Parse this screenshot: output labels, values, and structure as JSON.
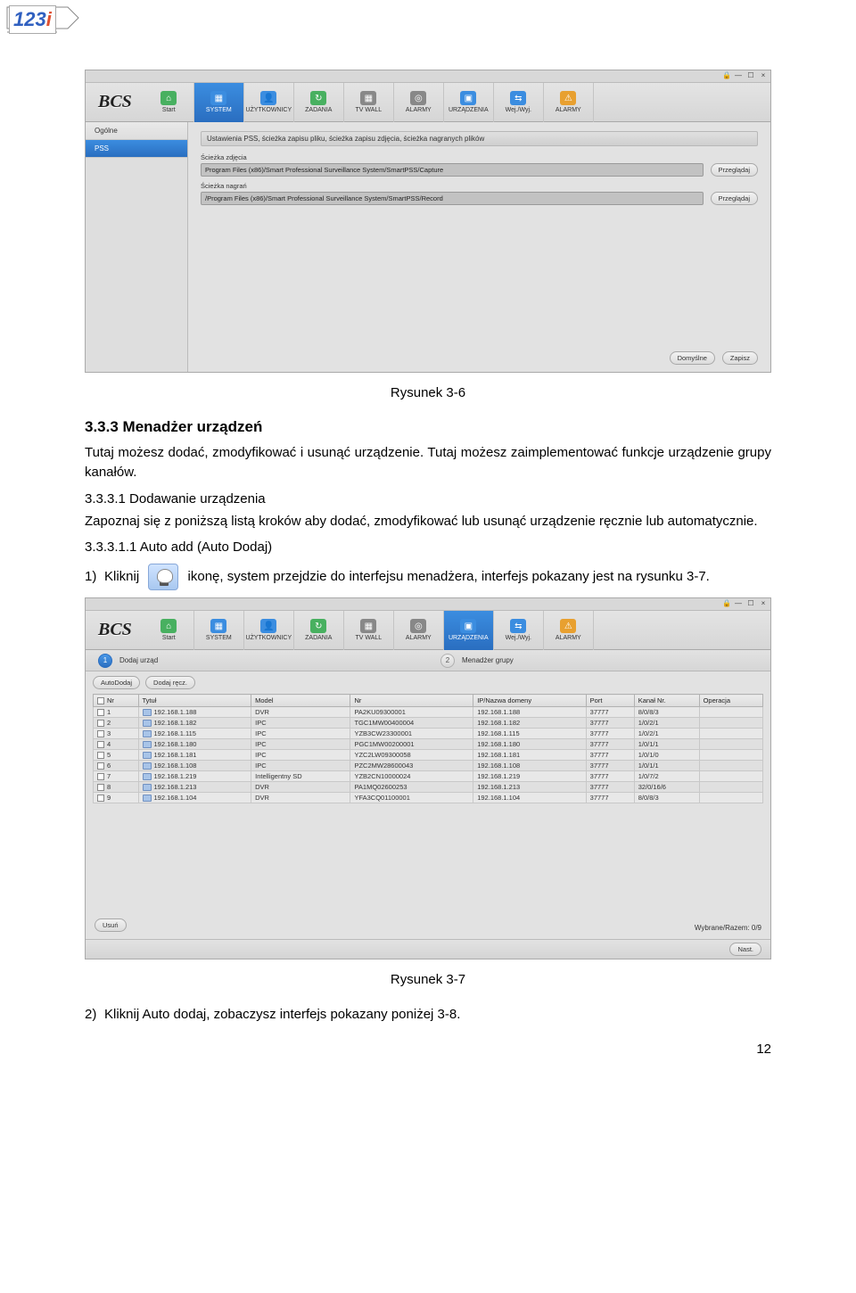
{
  "logo": {
    "part1": "123",
    "part2": "i"
  },
  "shot1": {
    "winbtns": [
      "🔒",
      "—",
      "☐",
      "×"
    ],
    "logo": "BCS",
    "nav": [
      {
        "label": "Start",
        "color": "#48b060",
        "glyph": "⌂"
      },
      {
        "label": "SYSTEM",
        "color": "#3b8de0",
        "glyph": "▦",
        "active": true
      },
      {
        "label": "UŻYTKOWNICY",
        "color": "#3b8de0",
        "glyph": "👤"
      },
      {
        "label": "ZADANIA",
        "color": "#48b060",
        "glyph": "↻"
      },
      {
        "label": "TV WALL",
        "color": "#888",
        "glyph": "▦"
      },
      {
        "label": "ALARMY",
        "color": "#888",
        "glyph": "◎"
      },
      {
        "label": "URZĄDZENIA",
        "color": "#3b8de0",
        "glyph": "▣"
      },
      {
        "label": "Wej./Wyj.",
        "color": "#3b8de0",
        "glyph": "⇆"
      },
      {
        "label": "ALARMY",
        "color": "#e8a030",
        "glyph": "⚠"
      }
    ],
    "sidebar": [
      {
        "label": "Ogólne"
      },
      {
        "label": "PSS",
        "active": true
      }
    ],
    "header": "Ustawienia PSS, ścieżka zapisu pliku, ścieżka zapisu zdjęcia, ścieżka nagranych plików",
    "field1_label": "Ścieżka zdjęcia",
    "field1_value": "Program Files (x86)/Smart Professional Surveillance System/SmartPSS/Capture",
    "field2_label": "Ścieżka nagrań",
    "field2_value": "/Program Files (x86)/Smart Professional Surveillance System/SmartPSS/Record",
    "browse": "Przeglądaj",
    "btn_default": "Domyślne",
    "btn_save": "Zapisz"
  },
  "caption1": "Rysunek 3-6",
  "h3": "3.3.3 Menadżer urządzeń",
  "p1": "Tutaj możesz dodać, zmodyfikować i usunąć urządzenie. Tutaj możesz zaimplementować funkcje urządzenie grupy kanałów.",
  "sub1": "3.3.3.1 Dodawanie urządzenia",
  "p2": "Zapoznaj się z poniższą listą kroków aby dodać, zmodyfikować lub usunąć urządzenie ręcznie lub automatycznie.",
  "sub2": "3.3.3.1.1   Auto add  (Auto Dodaj)",
  "step1_num": "1)",
  "step1a": "Kliknij",
  "step1b": "ikonę, system przejdzie do interfejsu menadżera, interfejs pokazany jest na rysunku 3-7.",
  "shot2": {
    "winbtns": [
      "🔒",
      "—",
      "☐",
      "×"
    ],
    "logo": "BCS",
    "nav": [
      {
        "label": "Start",
        "color": "#48b060",
        "glyph": "⌂"
      },
      {
        "label": "SYSTEM",
        "color": "#3b8de0",
        "glyph": "▦"
      },
      {
        "label": "UŻYTKOWNICY",
        "color": "#3b8de0",
        "glyph": "👤"
      },
      {
        "label": "ZADANIA",
        "color": "#48b060",
        "glyph": "↻"
      },
      {
        "label": "TV WALL",
        "color": "#888",
        "glyph": "▦"
      },
      {
        "label": "ALARMY",
        "color": "#888",
        "glyph": "◎"
      },
      {
        "label": "URZĄDZENIA",
        "color": "#3b8de0",
        "glyph": "▣",
        "active": true
      },
      {
        "label": "Wej./Wyj.",
        "color": "#3b8de0",
        "glyph": "⇆"
      },
      {
        "label": "ALARMY",
        "color": "#e8a030",
        "glyph": "⚠"
      }
    ],
    "step1": "Dodaj urząd",
    "step2": "Menadżer grupy",
    "btn_auto": "AutoDodaj",
    "btn_man": "Dodaj ręcz.",
    "cols": [
      "Nr",
      "Tytuł",
      "Model",
      "Nr",
      "IP/Nazwa domeny",
      "Port",
      "Kanał Nr.",
      "Operacja"
    ],
    "rows": [
      [
        "1",
        "192.168.1.188",
        "DVR",
        "PA2KU09300001",
        "192.168.1.188",
        "37777",
        "8/0/8/3",
        ""
      ],
      [
        "2",
        "192.168.1.182",
        "IPC",
        "TGC1MW00400004",
        "192.168.1.182",
        "37777",
        "1/0/2/1",
        ""
      ],
      [
        "3",
        "192.168.1.115",
        "IPC",
        "YZB3CW23300001",
        "192.168.1.115",
        "37777",
        "1/0/2/1",
        ""
      ],
      [
        "4",
        "192.168.1.180",
        "IPC",
        "PGC1MW00200001",
        "192.168.1.180",
        "37777",
        "1/0/1/1",
        ""
      ],
      [
        "5",
        "192.168.1.181",
        "IPC",
        "YZC2LW09300058",
        "192.168.1.181",
        "37777",
        "1/0/1/0",
        ""
      ],
      [
        "6",
        "192.168.1.108",
        "IPC",
        "PZC2MW28600043",
        "192.168.1.108",
        "37777",
        "1/0/1/1",
        ""
      ],
      [
        "7",
        "192.168.1.219",
        "Intelligentny SD",
        "YZB2CN10000024",
        "192.168.1.219",
        "37777",
        "1/0/7/2",
        ""
      ],
      [
        "8",
        "192.168.1.213",
        "DVR",
        "PA1MQ02600253",
        "192.168.1.213",
        "37777",
        "32/0/16/6",
        ""
      ],
      [
        "9",
        "192.168.1.104",
        "DVR",
        "YFA3CQ01100001",
        "192.168.1.104",
        "37777",
        "8/0/8/3",
        ""
      ]
    ],
    "btn_del": "Usuń",
    "selected": "Wybrane/Razem:  0/9",
    "btn_next": "Nast."
  },
  "caption2": "Rysunek 3-7",
  "step2_num": "2)",
  "step2": "Kliknij Auto dodaj, zobaczysz interfejs pokazany poniżej 3-8.",
  "pagenum": "12"
}
